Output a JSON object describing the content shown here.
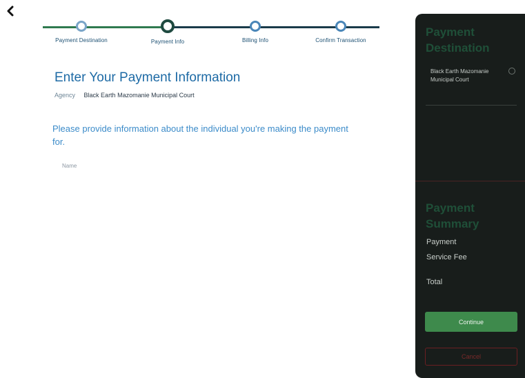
{
  "nav": {
    "back_icon": "chevron-left-icon"
  },
  "stepper": {
    "steps": [
      {
        "label": "Payment Destination",
        "state": "complete"
      },
      {
        "label": "Payment Info",
        "state": "active"
      },
      {
        "label": "Billing Info",
        "state": "upcoming"
      },
      {
        "label": "Confirm Transaction",
        "state": "upcoming"
      }
    ]
  },
  "main": {
    "title": "Enter Your Payment Information",
    "agency_label": "Agency",
    "agency_value": "Black Earth Mazomanie Municipal Court",
    "instructions": "Please provide information about the individual you're making the payment for.",
    "name_label": "Name"
  },
  "side_panel": {
    "destination_heading": "Payment Destination",
    "destination_name": "Black Earth Mazomanie Municipal Court",
    "summary_heading": "Payment Summary",
    "payment_label": "Payment",
    "service_fee_label": "Service Fee",
    "total_label": "Total",
    "continue_label": "Continue",
    "cancel_label": "Cancel"
  },
  "colors": {
    "accent_blue": "#1d6aa5",
    "panel_bg": "#181d1b",
    "continue_green": "#3e8a4c",
    "cancel_red": "#6b1f22"
  }
}
